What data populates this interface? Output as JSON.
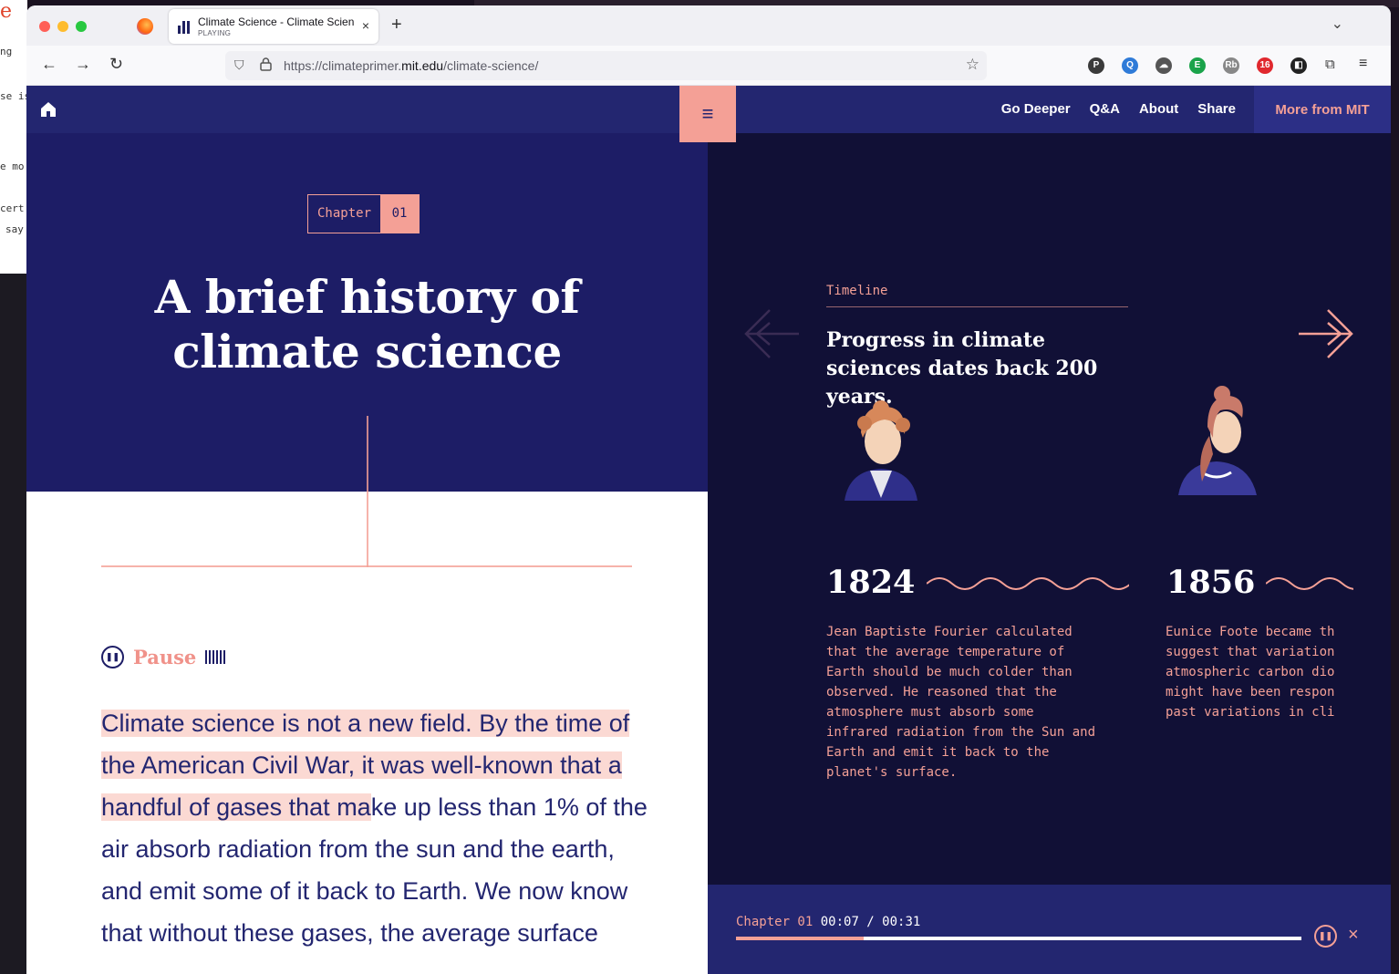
{
  "background": {
    "fragments": [
      "e",
      "ng",
      "se is",
      "e mo",
      "cert",
      "say"
    ]
  },
  "browser": {
    "tab": {
      "title": "Climate Science - Climate Scien",
      "subtitle": "PLAYING",
      "close": "×"
    },
    "new_tab": "+",
    "url": {
      "prefix": "https://climateprimer.",
      "domain": "mit.edu",
      "path": "/climate-science/"
    },
    "extensions": [
      {
        "name": "p-extension-icon",
        "label": "P",
        "color": "#3a3a3a"
      },
      {
        "name": "q-extension-icon",
        "label": "Q",
        "color": "#2f7bd8"
      },
      {
        "name": "cloud-extension-icon",
        "label": "☁",
        "color": "#555555"
      },
      {
        "name": "e-extension-icon",
        "label": "E",
        "color": "#1aa34a"
      },
      {
        "name": "rb-extension-icon",
        "label": "Rb",
        "color": "#888888"
      },
      {
        "name": "abp-extension-icon",
        "label": "16",
        "color": "#e0282e"
      },
      {
        "name": "dark-extension-icon",
        "label": "◧",
        "color": "#222222"
      }
    ]
  },
  "site": {
    "nav": {
      "links": [
        "Go Deeper",
        "Q&A",
        "About",
        "Share"
      ],
      "more": "More from MIT",
      "menu_icon": "≡"
    },
    "chapter": {
      "label": "Chapter",
      "number": "01"
    },
    "hero_title_line1": "A brief history of",
    "hero_title_line2": "climate science",
    "audio": {
      "pause_label": "Pause"
    },
    "body": {
      "highlighted": "Climate science is not a new field. By the time of the American Civil War, it was well-known that a handful of gases that ma",
      "rest": "ke up less than 1% of the air absorb radiation from the sun and the earth, and emit some of it back to Earth. We now know that without these gases, the average surface"
    },
    "timeline": {
      "label": "Timeline",
      "heading": "Progress in climate sciences dates back 200 years.",
      "entries": [
        {
          "year": "1824",
          "text": "Jean Baptiste Fourier calculated\nthat the average temperature of\nEarth should be much colder than\nobserved. He reasoned that the\natmosphere must absorb some\ninfrared radiation from the Sun and\nEarth and emit it back to the\nplanet's surface."
        },
        {
          "year": "1856",
          "text": "Eunice Foote became th\nsuggest that variation\natmospheric carbon dio\nmight have been respon\npast variations in cli"
        }
      ]
    },
    "player": {
      "chapter": "Chapter 01",
      "time": "00:07 / 00:31",
      "progress": 0.226,
      "close": "×"
    }
  },
  "colors": {
    "navy": "#1d1d66",
    "nav": "#232670",
    "dark": "#111036",
    "salmon": "#f4a096",
    "highlight": "#fbd9d3"
  }
}
